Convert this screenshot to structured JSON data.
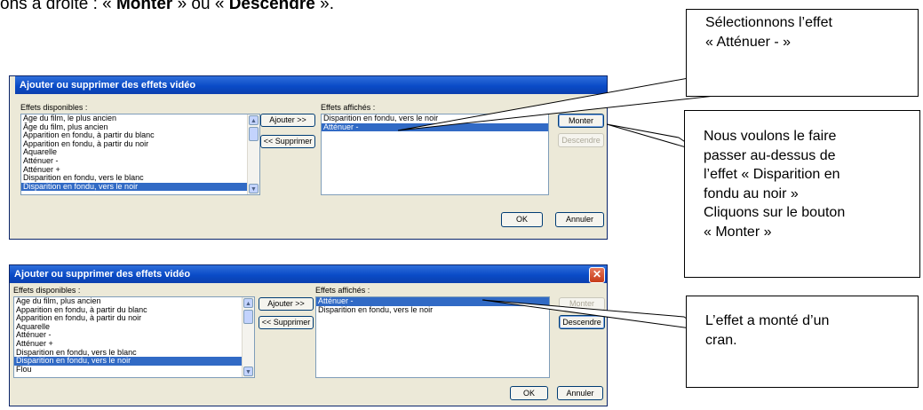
{
  "intro": {
    "prefix": "ons à droite : « ",
    "monter": "Monter",
    "middle": " » ou « ",
    "descendre": "Descendre",
    "suffix": " »."
  },
  "dialog1": {
    "available_label": "Effets disponibles :",
    "available": [
      "Âge du film, le plus ancien",
      "Âge du film, plus ancien",
      "Apparition en fondu, à partir du blanc",
      "Apparition en fondu, à partir du noir",
      "Aquarelle",
      "Atténuer -",
      "Atténuer +",
      "Disparition en fondu, vers le blanc",
      "Disparition en fondu, vers le noir"
    ],
    "available_selected": 8,
    "add_label": "Ajouter >>",
    "remove_label": "<< Supprimer",
    "displayed_label": "Effets affichés :",
    "displayed": [
      "Disparition en fondu, vers le noir",
      "Atténuer -"
    ],
    "displayed_selected": 1,
    "up_label": "Monter",
    "down_label": "Descendre",
    "ok_label": "OK",
    "cancel_label": "Annuler"
  },
  "dialog2": {
    "title": "Ajouter ou supprimer des effets vidéo",
    "available_label": "Effets disponibles :",
    "available": [
      "Âge du film, plus ancien",
      "Apparition en fondu, à partir du blanc",
      "Apparition en fondu, à partir du noir",
      "Aquarelle",
      "Atténuer -",
      "Atténuer +",
      "Disparition en fondu, vers le blanc",
      "Disparition en fondu, vers le noir",
      "Flou"
    ],
    "available_selected": 7,
    "add_label": "Ajouter >>",
    "remove_label": "<< Supprimer",
    "displayed_label": "Effets affichés :",
    "displayed": [
      "Atténuer -",
      "Disparition en fondu, vers le noir"
    ],
    "displayed_selected": 0,
    "up_label": "Monter",
    "down_label": "Descendre",
    "ok_label": "OK",
    "cancel_label": "Annuler"
  },
  "callouts": {
    "c1": [
      "Sélectionnons l’effet",
      "« Atténuer - »"
    ],
    "c2": [
      "Nous voulons le faire",
      "passer au-dessus de",
      "l’effet « Disparition en",
      "fondu au noir »",
      "Cliquons sur le bouton",
      "« Monter »"
    ],
    "c3": [
      "L’effet a monté d’un",
      "cran."
    ]
  }
}
